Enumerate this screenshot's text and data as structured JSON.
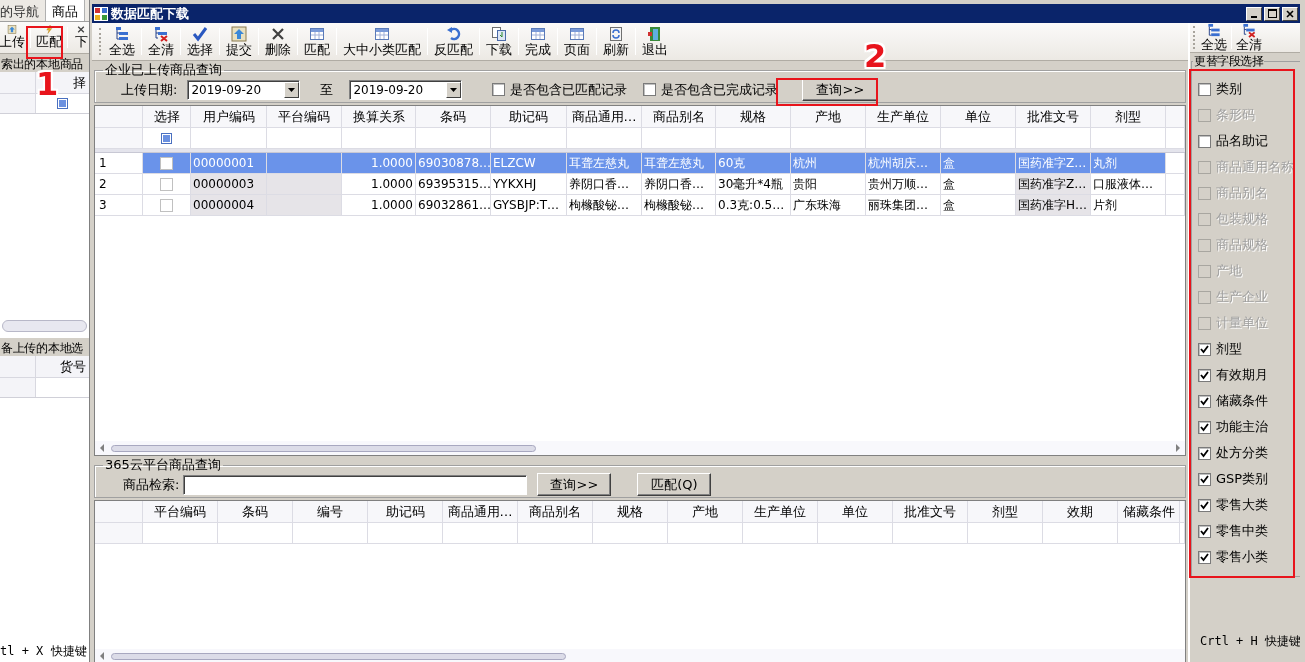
{
  "background_window": {
    "tabs": [
      {
        "label": "的导航",
        "selected": false
      },
      {
        "label": "商品",
        "selected": true
      }
    ],
    "toolbar": [
      "上传",
      "匹配",
      "下"
    ],
    "section_1": "索出的本地商品",
    "grid_1_columns": [
      "择"
    ],
    "section_2": "备上传的本地选",
    "grid_2_columns": [
      "货号"
    ],
    "status_text": "tl + X 快捷键"
  },
  "dialog": {
    "title": "数据匹配下载",
    "toolbar": [
      "全选",
      "全清",
      "选择",
      "提交",
      "删除",
      "匹配",
      "大中小类匹配",
      "反匹配",
      "下载",
      "完成",
      "页面",
      "刷新",
      "退出"
    ],
    "upload_query": {
      "title": "企业已上传商品查询",
      "date_label": "上传日期:",
      "date_from": "2019-09-20",
      "to_label": "至",
      "date_to": "2019-09-20",
      "options": [
        {
          "label": "是否包含已匹配记录",
          "checked": false
        },
        {
          "label": "是否包含已完成记录",
          "checked": false
        }
      ],
      "button": "查询>>"
    },
    "upload_table": {
      "columns": [
        {
          "label": "选择",
          "readonly": false
        },
        {
          "label": "用户编码",
          "readonly": true
        },
        {
          "label": "平台编码",
          "readonly": true
        },
        {
          "label": "换算关系",
          "readonly": false
        },
        {
          "label": "条码",
          "readonly": false
        },
        {
          "label": "助记码",
          "readonly": false
        },
        {
          "label": "商品通用…",
          "readonly": false
        },
        {
          "label": "商品别名",
          "readonly": false
        },
        {
          "label": "规格",
          "readonly": false
        },
        {
          "label": "产地",
          "readonly": false
        },
        {
          "label": "生产单位",
          "readonly": false
        },
        {
          "label": "单位",
          "readonly": false
        },
        {
          "label": "批准文号",
          "readonly": true
        },
        {
          "label": "剂型",
          "readonly": false
        }
      ],
      "rows": [
        {
          "number": "1",
          "selected": true,
          "checked": false,
          "cells": [
            "",
            "00000001",
            "",
            "1.0000",
            "69030878…",
            "ELZCW",
            "耳聋左慈丸",
            "耳聋左慈丸",
            "60克",
            "杭州",
            "杭州胡庆…",
            "盒",
            "国药准字Z…",
            "丸剂"
          ]
        },
        {
          "number": "2",
          "selected": false,
          "checked": false,
          "cells": [
            "",
            "00000003",
            "",
            "1.0000",
            "69395315…",
            "YYKXHJ",
            "养阴口香…",
            "养阴口香…",
            "30毫升*4瓶",
            "贵阳",
            "贵州万顺…",
            "盒",
            "国药准字Z…",
            "口服液体…"
          ]
        },
        {
          "number": "3",
          "selected": false,
          "checked": false,
          "cells": [
            "",
            "00000004",
            "",
            "1.0000",
            "69032861…",
            "GYSBJP:T…",
            "枸橼酸铋…",
            "枸橼酸铋…",
            "0.3克:0.5…",
            "广东珠海",
            "丽珠集团…",
            "盒",
            "国药准字H…",
            "片剂"
          ]
        }
      ]
    },
    "cloud_query": {
      "title": "365云平台商品查询",
      "search_label": "商品检索:",
      "buttons": [
        "查询>>",
        "匹配(Q)"
      ]
    },
    "cloud_table": {
      "columns": [
        "平台编码",
        "条码",
        "编号",
        "助记码",
        "商品通用…",
        "商品别名",
        "规格",
        "产地",
        "生产单位",
        "单位",
        "批准文号",
        "剂型",
        "效期",
        "储藏条件"
      ]
    },
    "field_panel": {
      "toolbar": [
        "全选",
        "全清"
      ],
      "title": "更替字段选择",
      "fields": [
        {
          "label": "类别",
          "checked": false,
          "disabled": false
        },
        {
          "label": "条形码",
          "checked": false,
          "disabled": true
        },
        {
          "label": "品名助记",
          "checked": false,
          "disabled": false
        },
        {
          "label": "商品通用名称",
          "checked": false,
          "disabled": true
        },
        {
          "label": "商品别名",
          "checked": false,
          "disabled": true
        },
        {
          "label": "包装规格",
          "checked": false,
          "disabled": true
        },
        {
          "label": "商品规格",
          "checked": false,
          "disabled": true
        },
        {
          "label": "产地",
          "checked": false,
          "disabled": true
        },
        {
          "label": "生产企业",
          "checked": false,
          "disabled": true
        },
        {
          "label": "计量单位",
          "checked": false,
          "disabled": true
        },
        {
          "label": "剂型",
          "checked": true,
          "disabled": false
        },
        {
          "label": "有效期月",
          "checked": true,
          "disabled": false
        },
        {
          "label": "储藏条件",
          "checked": true,
          "disabled": false
        },
        {
          "label": "功能主治",
          "checked": true,
          "disabled": false
        },
        {
          "label": "处方分类",
          "checked": true,
          "disabled": false
        },
        {
          "label": "GSP类别",
          "checked": true,
          "disabled": false
        },
        {
          "label": "零售大类",
          "checked": true,
          "disabled": false
        },
        {
          "label": "零售中类",
          "checked": true,
          "disabled": false
        },
        {
          "label": "零售小类",
          "checked": true,
          "disabled": false
        }
      ],
      "shortcut": "Crtl + H 快捷键"
    }
  },
  "annotations": [
    {
      "label": "1"
    },
    {
      "label": "2"
    }
  ]
}
